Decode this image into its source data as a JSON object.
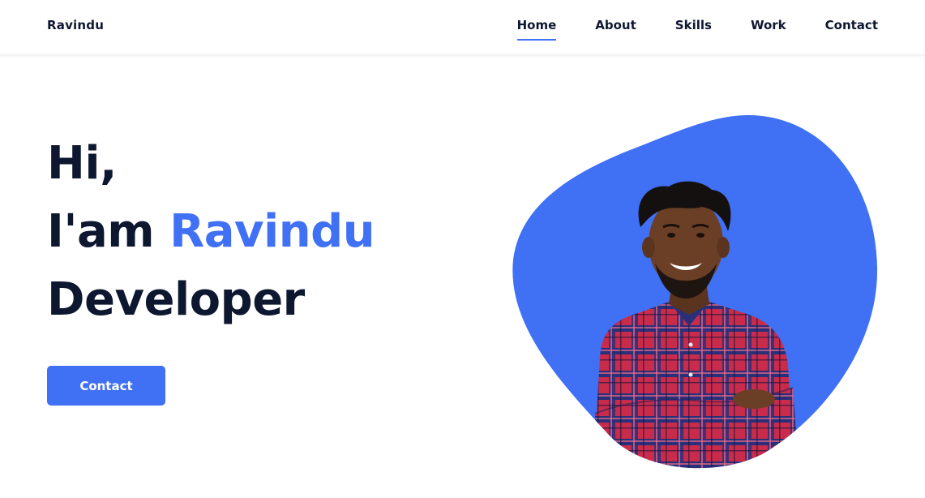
{
  "header": {
    "brand": "Ravindu",
    "nav": [
      {
        "label": "Home",
        "active": true
      },
      {
        "label": "About",
        "active": false
      },
      {
        "label": "Skills",
        "active": false
      },
      {
        "label": "Work",
        "active": false
      },
      {
        "label": "Contact",
        "active": false
      }
    ]
  },
  "hero": {
    "greeting": "Hi,",
    "intro_prefix": "I'am ",
    "name": "Ravindu",
    "role": "Developer",
    "cta_label": "Contact"
  },
  "colors": {
    "accent": "#4070f4",
    "text_dark": "#0e1730",
    "background": "#ffffff"
  },
  "image": {
    "subject": "portrait-of-smiling-man-in-plaid-shirt-arms-crossed"
  }
}
